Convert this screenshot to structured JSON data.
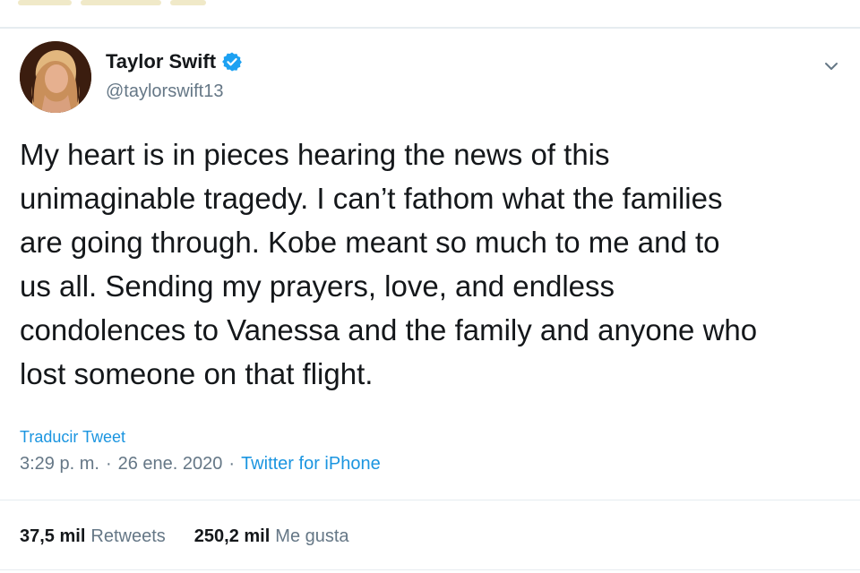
{
  "tweet": {
    "author": {
      "display_name": "Taylor Swift",
      "handle": "@taylorswift13",
      "verified": true,
      "verified_icon": "verified-badge-icon"
    },
    "menu_icon": "chevron-down-icon",
    "text": "My heart is in pieces hearing the news of this\nunimaginable tragedy. I can’t fathom what the families\nare going through. Kobe meant so much to me and to\nus all. Sending my prayers, love, and endless\ncondolences to Vanessa and the family and anyone who\nlost someone on that flight.",
    "translate_label": "Traducir Tweet",
    "time": "3:29 p. m.",
    "date": "26 ene. 2020",
    "separator": "·",
    "source": "Twitter for iPhone",
    "stats": {
      "retweets_count": "37,5 mil",
      "retweets_label": "Retweets",
      "likes_count": "250,2 mil",
      "likes_label": "Me gusta"
    }
  },
  "colors": {
    "text": "#14171a",
    "secondary": "#657786",
    "link": "#1b95e0",
    "divider": "#e6ecf0"
  }
}
